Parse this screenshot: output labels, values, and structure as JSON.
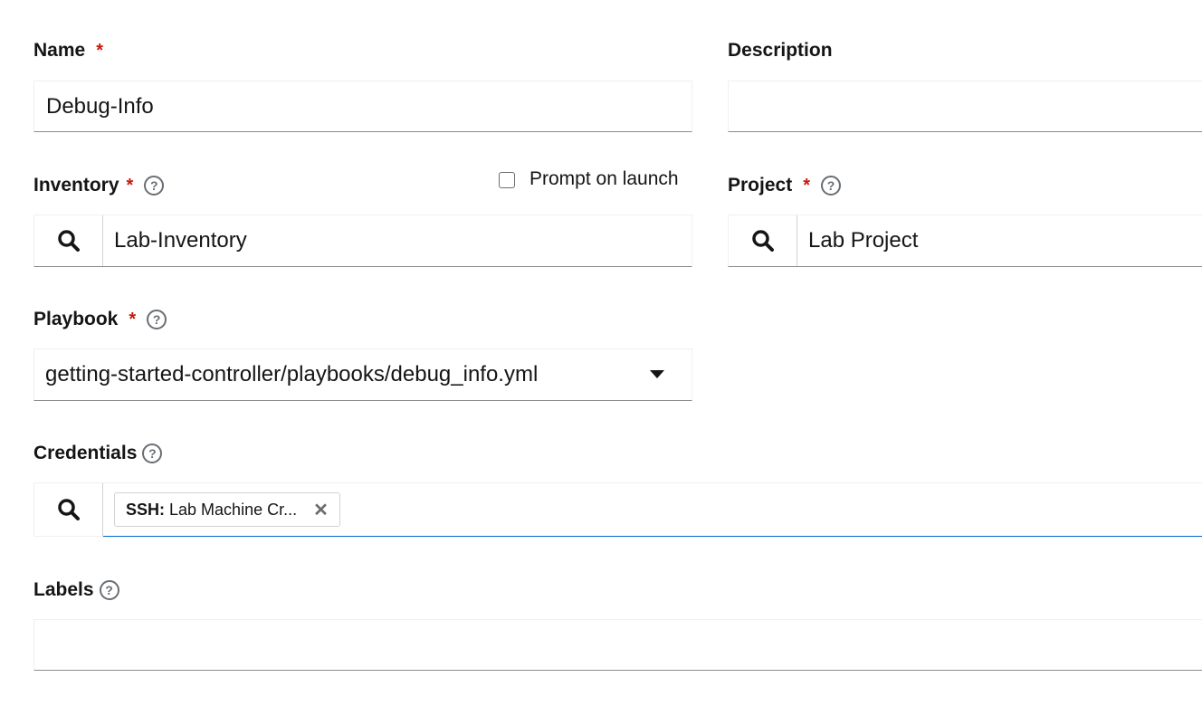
{
  "name": {
    "label": "Name",
    "required": "*",
    "value": "Debug-Info"
  },
  "description": {
    "label": "Description",
    "value": ""
  },
  "inventory": {
    "label": "Inventory",
    "required": "*",
    "help": "?",
    "prompt_on_launch": "Prompt on launch",
    "prompt_checked": false,
    "value": "Lab-Inventory"
  },
  "project": {
    "label": "Project",
    "required": "*",
    "help": "?",
    "value": "Lab Project"
  },
  "playbook": {
    "label": "Playbook",
    "required": "*",
    "help": "?",
    "value": "getting-started-controller/playbooks/debug_info.yml"
  },
  "credentials": {
    "label": "Credentials",
    "help": "?",
    "chips": [
      {
        "type": "SSH:",
        "name": "Lab Machine Cr..."
      }
    ]
  },
  "labels": {
    "label": "Labels",
    "help": "?",
    "value": ""
  },
  "icons": {
    "search": "search-icon",
    "caret": "caret-down-icon",
    "remove": "close-icon"
  },
  "colors": {
    "required": "#c9190b",
    "focus_underline": "#0066cc",
    "border": "#8a8d90"
  }
}
